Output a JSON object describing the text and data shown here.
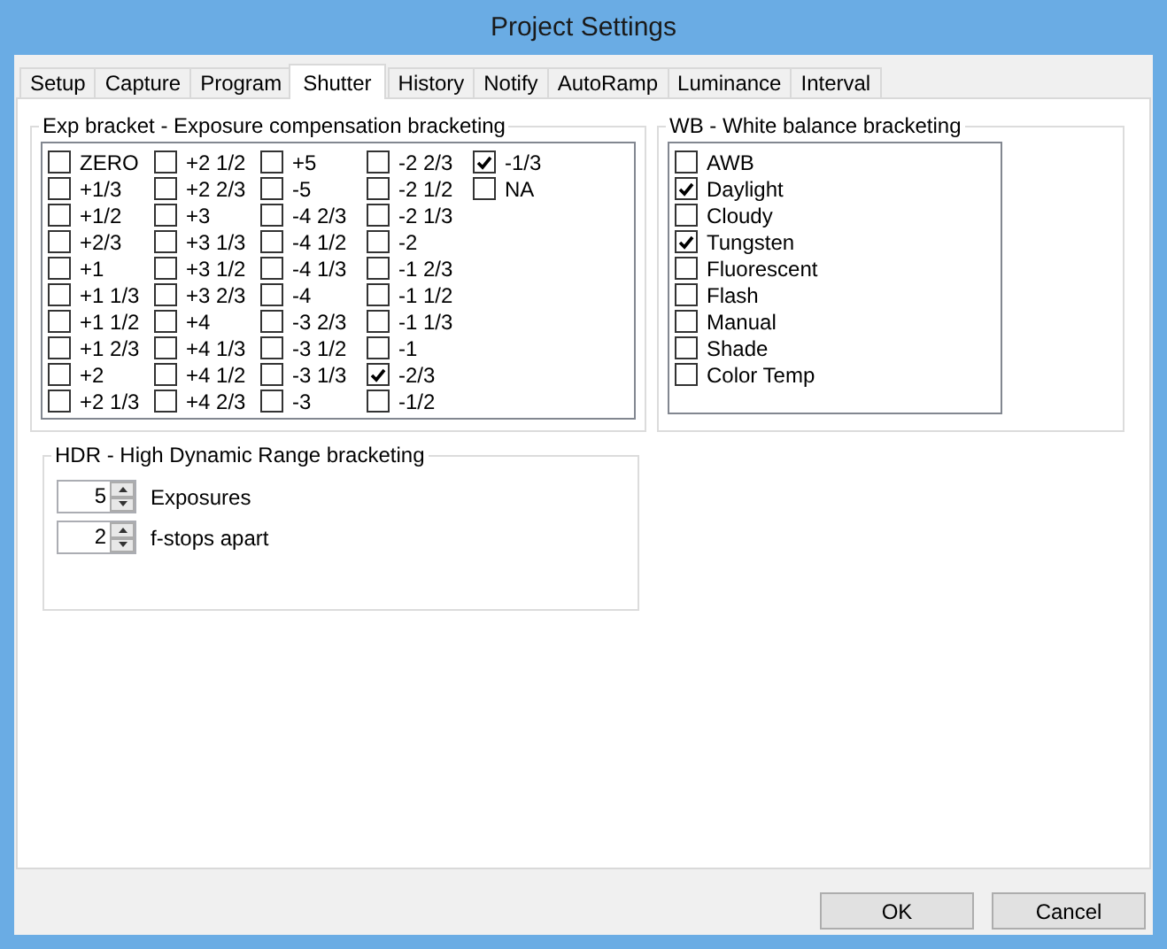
{
  "window": {
    "title": "Project Settings"
  },
  "tabs": [
    {
      "label": "Setup",
      "selected": false
    },
    {
      "label": "Capture",
      "selected": false
    },
    {
      "label": "Program",
      "selected": false
    },
    {
      "label": "Shutter",
      "selected": true
    },
    {
      "label": "History",
      "selected": false
    },
    {
      "label": "Notify",
      "selected": false
    },
    {
      "label": "AutoRamp",
      "selected": false
    },
    {
      "label": "Luminance",
      "selected": false
    },
    {
      "label": "Interval",
      "selected": false
    }
  ],
  "exp_bracket": {
    "title": "Exp bracket - Exposure compensation bracketing",
    "columns": [
      {
        "items": [
          {
            "label": "ZERO",
            "checked": false
          },
          {
            "label": "+1/3",
            "checked": false
          },
          {
            "label": "+1/2",
            "checked": false
          },
          {
            "label": "+2/3",
            "checked": false
          },
          {
            "label": "+1",
            "checked": false
          },
          {
            "label": "+1 1/3",
            "checked": false
          },
          {
            "label": "+1 1/2",
            "checked": false
          },
          {
            "label": "+1 2/3",
            "checked": false
          },
          {
            "label": "+2",
            "checked": false
          },
          {
            "label": "+2 1/3",
            "checked": false
          }
        ]
      },
      {
        "items": [
          {
            "label": "+2 1/2",
            "checked": false
          },
          {
            "label": "+2 2/3",
            "checked": false
          },
          {
            "label": "+3",
            "checked": false
          },
          {
            "label": "+3 1/3",
            "checked": false
          },
          {
            "label": "+3 1/2",
            "checked": false
          },
          {
            "label": "+3 2/3",
            "checked": false
          },
          {
            "label": "+4",
            "checked": false
          },
          {
            "label": "+4 1/3",
            "checked": false
          },
          {
            "label": "+4 1/2",
            "checked": false
          },
          {
            "label": "+4 2/3",
            "checked": false
          }
        ]
      },
      {
        "items": [
          {
            "label": "+5",
            "checked": false
          },
          {
            "label": "-5",
            "checked": false
          },
          {
            "label": "-4 2/3",
            "checked": false
          },
          {
            "label": "-4 1/2",
            "checked": false
          },
          {
            "label": "-4 1/3",
            "checked": false
          },
          {
            "label": "-4",
            "checked": false
          },
          {
            "label": "-3 2/3",
            "checked": false
          },
          {
            "label": "-3 1/2",
            "checked": false
          },
          {
            "label": "-3 1/3",
            "checked": false
          },
          {
            "label": "-3",
            "checked": false
          }
        ]
      },
      {
        "items": [
          {
            "label": "-2 2/3",
            "checked": false
          },
          {
            "label": "-2 1/2",
            "checked": false
          },
          {
            "label": "-2 1/3",
            "checked": false
          },
          {
            "label": "-2",
            "checked": false
          },
          {
            "label": "-1 2/3",
            "checked": false
          },
          {
            "label": "-1 1/2",
            "checked": false
          },
          {
            "label": "-1 1/3",
            "checked": false
          },
          {
            "label": "-1",
            "checked": false
          },
          {
            "label": "-2/3",
            "checked": true
          },
          {
            "label": "-1/2",
            "checked": false
          }
        ]
      },
      {
        "items": [
          {
            "label": "-1/3",
            "checked": true
          },
          {
            "label": "NA",
            "checked": false
          }
        ]
      }
    ]
  },
  "wb_bracket": {
    "title": "WB - White balance bracketing",
    "items": [
      {
        "label": "AWB",
        "checked": false
      },
      {
        "label": "Daylight",
        "checked": true
      },
      {
        "label": "Cloudy",
        "checked": false
      },
      {
        "label": "Tungsten",
        "checked": true
      },
      {
        "label": "Fluorescent",
        "checked": false
      },
      {
        "label": "Flash",
        "checked": false
      },
      {
        "label": "Manual",
        "checked": false
      },
      {
        "label": "Shade",
        "checked": false
      },
      {
        "label": "Color Temp",
        "checked": false
      }
    ]
  },
  "hdr": {
    "title": "HDR - High Dynamic Range bracketing",
    "fields": [
      {
        "value": "5",
        "label": "Exposures"
      },
      {
        "value": "2",
        "label": "f-stops apart"
      }
    ]
  },
  "buttons": [
    "OK",
    "Cancel"
  ]
}
